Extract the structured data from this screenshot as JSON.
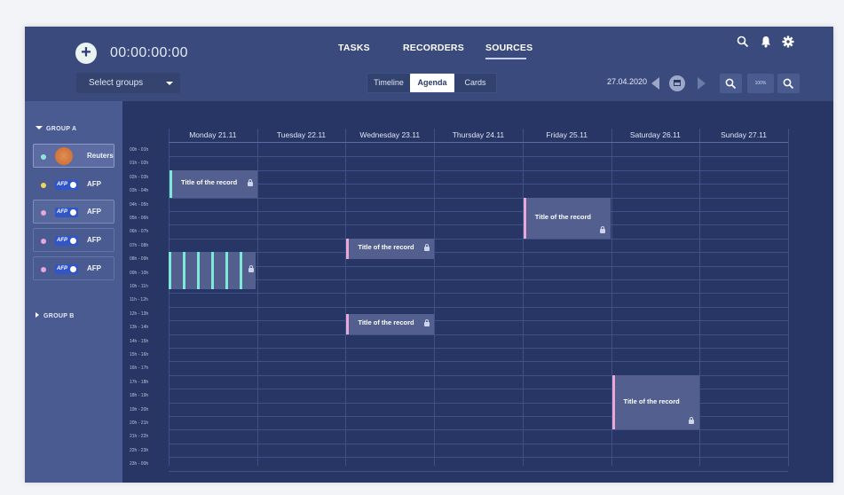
{
  "header": {
    "timer": "00:00:00:00",
    "nav_tabs": [
      {
        "label": "TASKS",
        "active": false
      },
      {
        "label": "RECORDERS",
        "active": false
      },
      {
        "label": "SOURCES",
        "active": true
      }
    ],
    "select_groups": "Select groups",
    "views": [
      {
        "label": "Timeline",
        "active": false
      },
      {
        "label": "Agenda",
        "active": true
      },
      {
        "label": "Cards",
        "active": false
      }
    ],
    "date": "27.04.2020",
    "zoom": "100%",
    "icons": [
      "search-icon",
      "bell-icon",
      "gear-icon",
      "calendar-icon",
      "zoom-out-icon",
      "zoom-in-icon"
    ]
  },
  "sidebar": {
    "group_a": "GROUP A",
    "group_b": "GROUP B",
    "sources": [
      {
        "label": "Reuters",
        "logo": "reuters-logo",
        "dot_color": "#8ee6da",
        "state": "selected"
      },
      {
        "label": "AFP",
        "logo": "afp-logo",
        "dot_color": "#f2d45c",
        "state": "normal"
      },
      {
        "label": "AFP",
        "logo": "afp-logo",
        "dot_color": "#e9a6d6",
        "state": "highlighted"
      },
      {
        "label": "AFP",
        "logo": "afp-logo",
        "dot_color": "#e9a6d6",
        "state": "normal"
      },
      {
        "label": "AFP",
        "logo": "afp-logo",
        "dot_color": "#e9a6d6",
        "state": "normal"
      }
    ]
  },
  "calendar": {
    "days": [
      "Monday 21.11",
      "Tuesday 22.11",
      "Wednesday 23.11",
      "Thursday 24.11",
      "Friday 25.11",
      "Saturday 26.11",
      "Sunday 27.11"
    ],
    "hours": [
      "00h - 01h",
      "01h - 02h",
      "02h - 03h",
      "03h - 04h",
      "04h - 05h",
      "05h - 06h",
      "06h - 07h",
      "07h - 08h",
      "08h - 09h",
      "09h - 10h",
      "10h - 11h",
      "11h - 12h",
      "12h - 13h",
      "13h - 14h",
      "14h - 15h",
      "15h - 16h",
      "16h - 17h",
      "17h - 18h",
      "18h - 19h",
      "19h - 20h",
      "20h - 21h",
      "21h - 22h",
      "22h - 23h",
      "23h - 00h"
    ],
    "events": [
      {
        "title": "Title of the record",
        "day": 0,
        "start": 2,
        "end": 4,
        "accent": "#7ee8d6"
      },
      {
        "title": "Title of the record",
        "day": 2,
        "start": 7,
        "end": 8.5,
        "accent": "#e9a6d6"
      },
      {
        "title": "Title of the record",
        "day": 2,
        "start": 12.5,
        "end": 14,
        "accent": "#e9a6d6"
      },
      {
        "title": "Title of the record",
        "day": 4,
        "start": 4,
        "end": 7,
        "accent": "#e9a6d6"
      },
      {
        "title": "Title of the record",
        "day": 5,
        "start": 17,
        "end": 21,
        "accent": "#e9a6d6"
      }
    ],
    "striped_block": {
      "day": 0,
      "start": 8,
      "end": 10.7,
      "stripe_color": "#7ee8d6"
    }
  }
}
